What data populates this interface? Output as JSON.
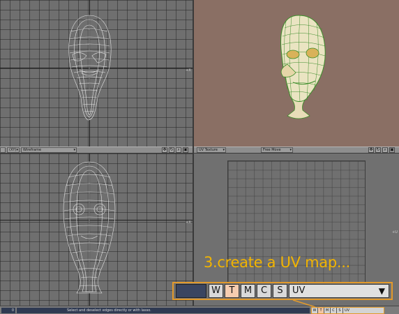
{
  "viewports": {
    "bottom_left_header": {
      "view_dropdown": "(XY)",
      "render_dropdown": "Wireframe"
    },
    "bottom_right_header": {
      "view_dropdown": "UV Texture",
      "mode_dropdown": "Free Move"
    }
  },
  "statusbar": {
    "field_value": "0",
    "message": "Select and deselect edges directly or with lasso.",
    "mini_buttons": [
      "W",
      "T",
      "M",
      "C",
      "S"
    ],
    "mini_dropdown": "UV"
  },
  "caption": "3.create a UV map...",
  "zoom_toolbar": {
    "buttons": [
      "W",
      "T",
      "M",
      "C",
      "S"
    ],
    "active": "T",
    "dropdown": "UV"
  },
  "colors": {
    "highlight": "#e39a2b",
    "caption": "#f2b400",
    "perspective_bg": "#8a6f64",
    "mesh_green": "#3c8d2a",
    "active_button": "#f6cdb0"
  },
  "icons": [
    "move-icon",
    "rotate-icon",
    "zoom-icon",
    "maximize-icon"
  ]
}
